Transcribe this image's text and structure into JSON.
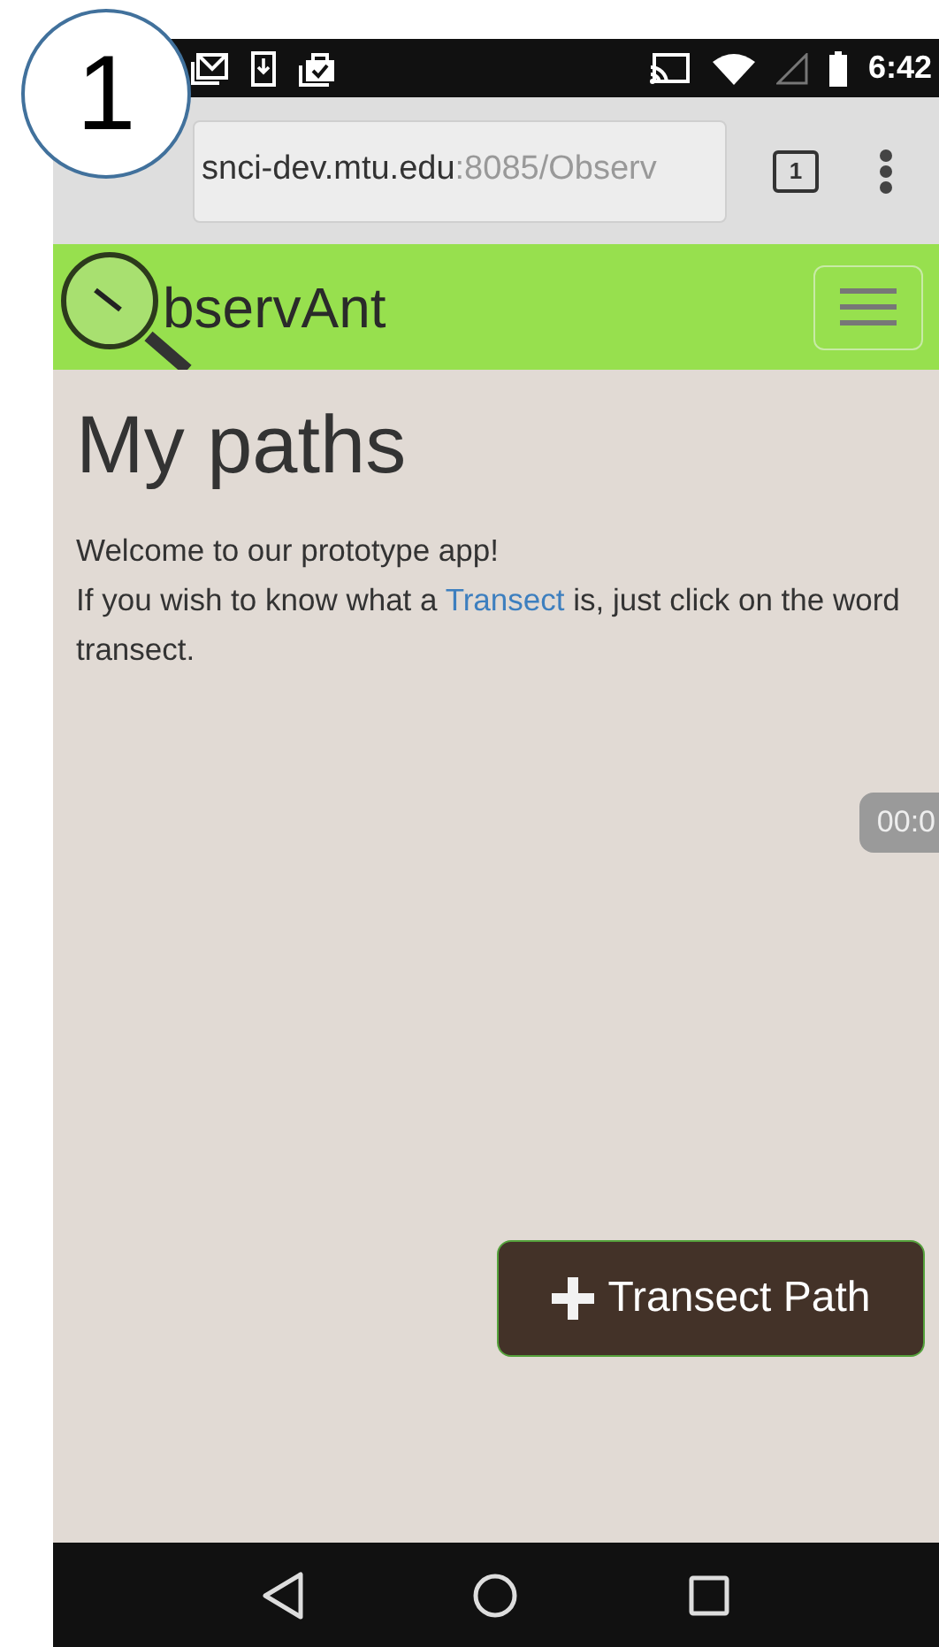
{
  "annotation": {
    "label": "1"
  },
  "status_bar": {
    "time": "6:42"
  },
  "browser": {
    "url_host": "snci-dev.mtu.edu",
    "url_path": ":8085/Observ",
    "tab_count": "1"
  },
  "navbar": {
    "brand": "bservAnt"
  },
  "page": {
    "title": "My paths",
    "welcome": "Welcome to our prototype app!",
    "info_before": "If you wish to know what a",
    "info_link": "Transect",
    "info_after": "is, just click on the word transect."
  },
  "timer": "00:0",
  "action_button": {
    "label": "Transect Path"
  }
}
